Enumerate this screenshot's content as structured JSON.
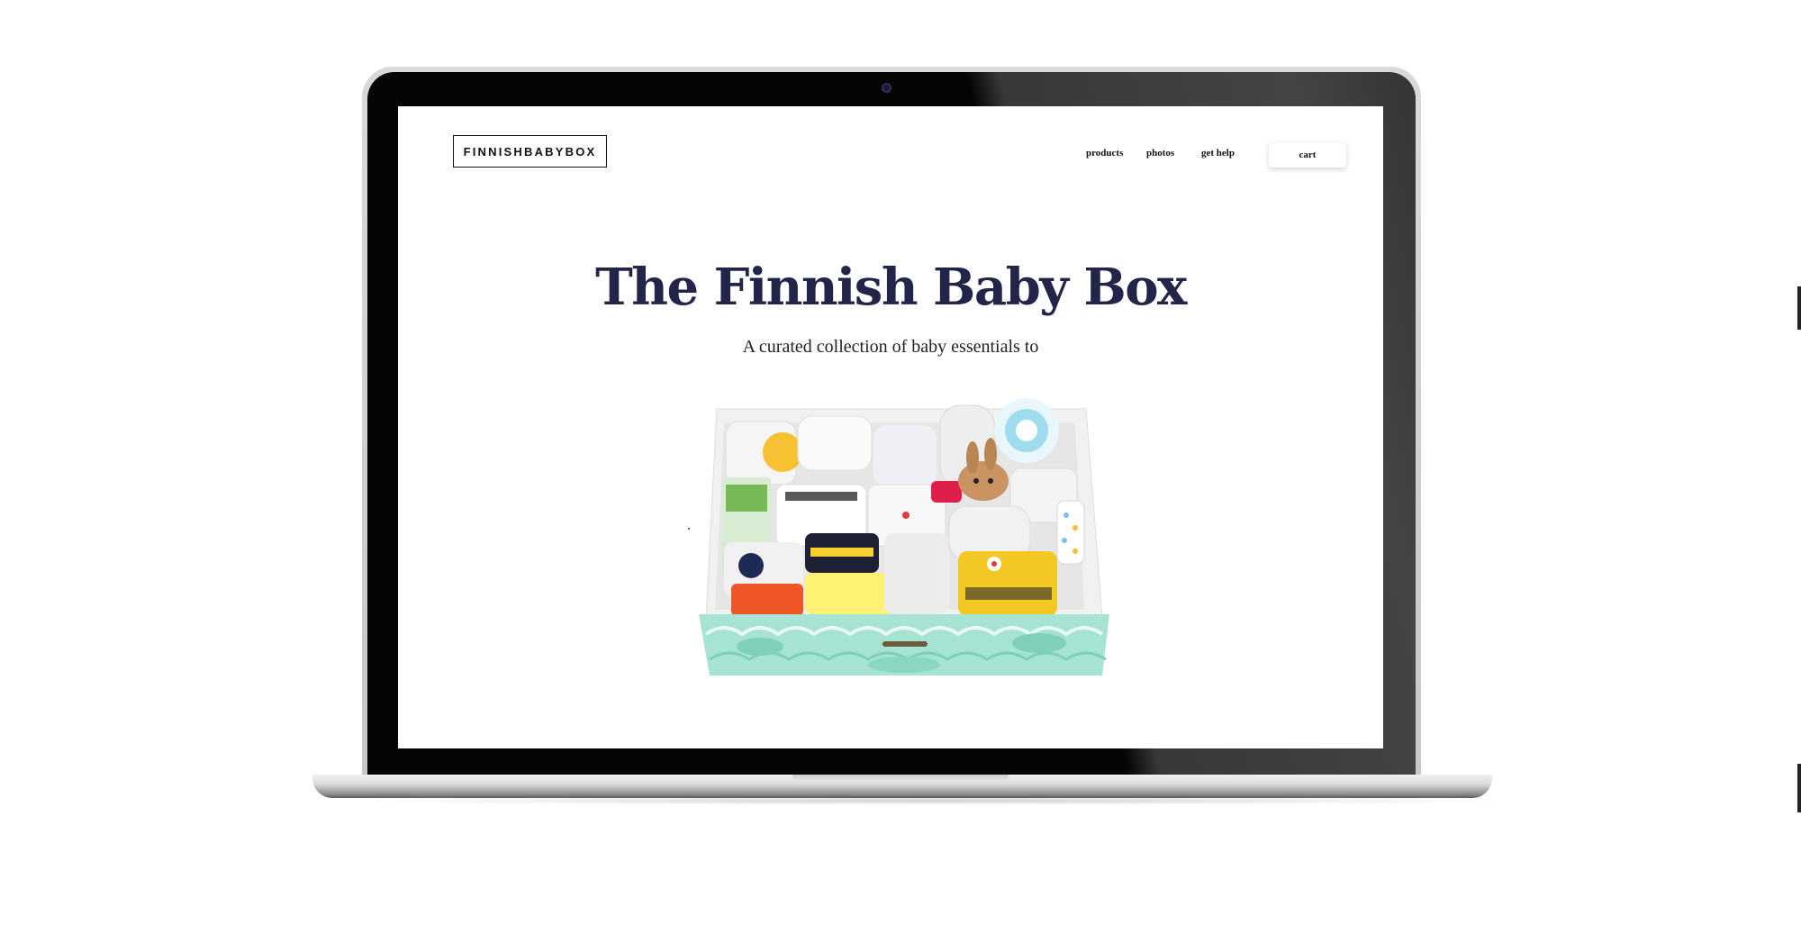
{
  "site": {
    "logo": "FINNISHBABYBOX",
    "nav": [
      {
        "label": "products"
      },
      {
        "label": "photos"
      },
      {
        "label": "get help"
      }
    ],
    "cart_label": "cart"
  },
  "hero": {
    "title": "The Finnish Baby Box",
    "subtitle": "A curated collection of baby essentials to"
  },
  "colors": {
    "title": "#23244a",
    "box_mint": "#a6e3d3",
    "page_background": "#ffffff"
  },
  "icons": {
    "camera": "webcam-icon"
  }
}
